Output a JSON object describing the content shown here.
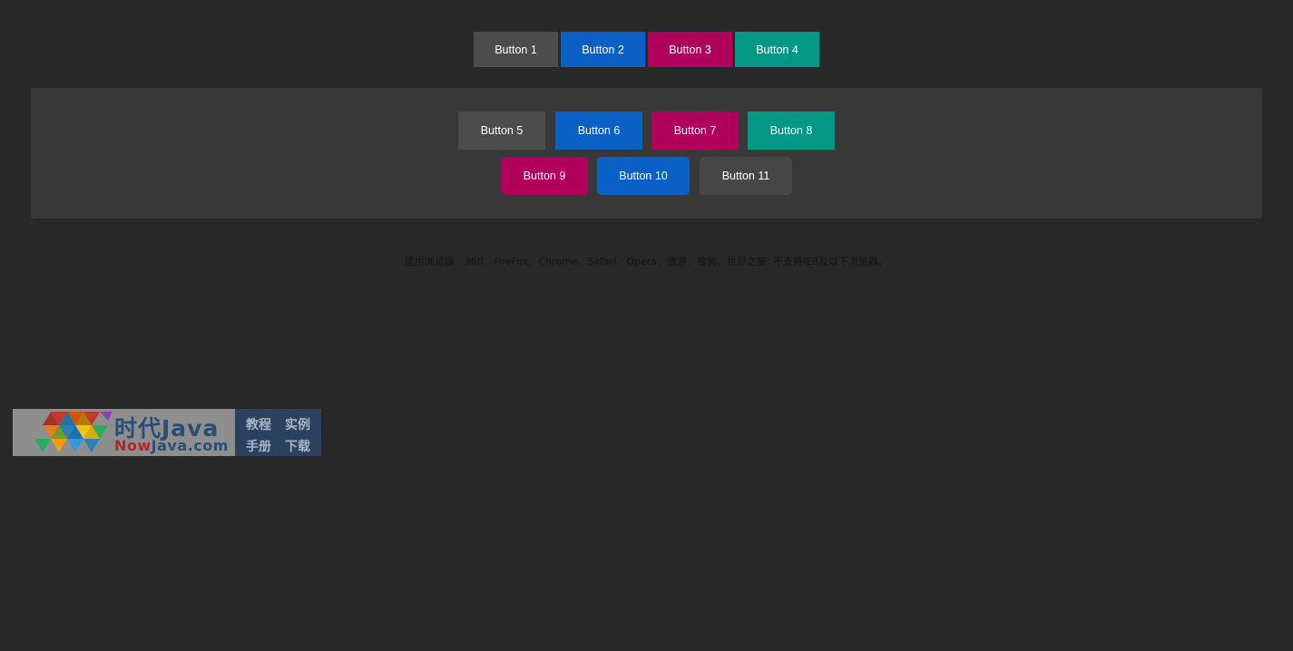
{
  "row1": {
    "buttons": [
      "Button 1",
      "Button 2",
      "Button 3",
      "Button 4"
    ]
  },
  "panel": {
    "row_a": [
      "Button 5",
      "Button 6",
      "Button 7",
      "Button 8"
    ],
    "row_b": [
      "Button 9",
      "Button 10",
      "Button 11"
    ]
  },
  "note": "适用浏览器：360、FireFox、Chrome、Safari、Opera、傲游、搜狗、世界之窗. 不支持IE8及以下浏览器。",
  "banner": {
    "brand_cn": "时代Java",
    "brand_en_prefix": "Now",
    "brand_en_suffix": "Java.com",
    "links": [
      "教程",
      "实例",
      "手册",
      "下载"
    ]
  },
  "colors": {
    "background": "#282828",
    "panel": "#383838",
    "gray": "#4c4c4c",
    "blue": "#0a60c4",
    "red": "#b1005c",
    "teal": "#039785"
  }
}
